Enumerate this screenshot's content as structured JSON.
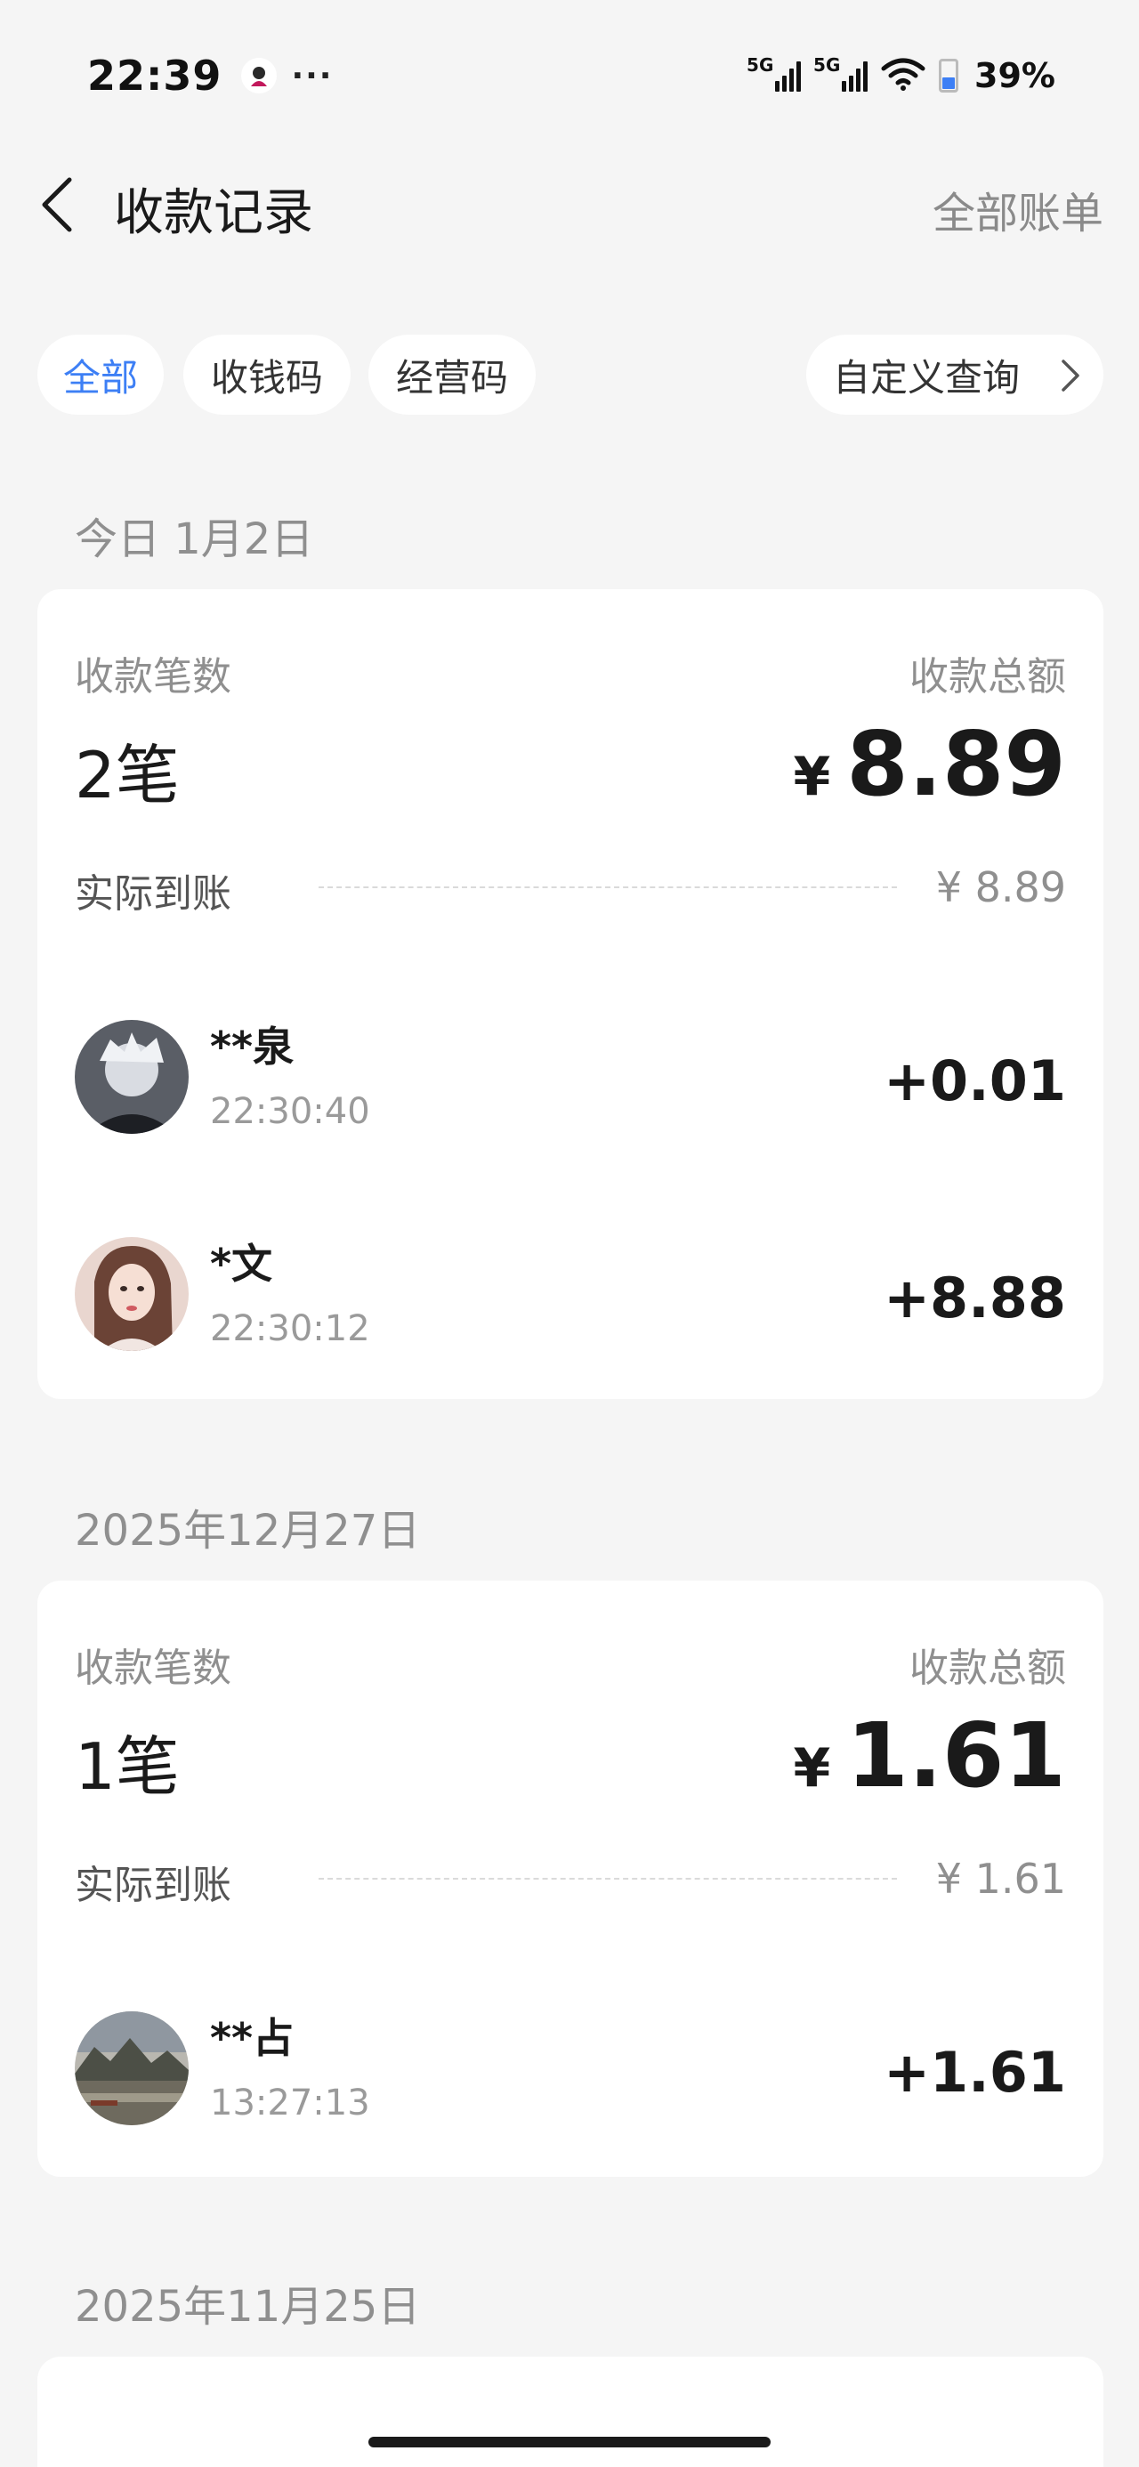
{
  "status_bar": {
    "time": "22:39",
    "dots": "···",
    "network_1": "5G",
    "network_2": "5G",
    "battery_percent": "39%",
    "battery_level": 0.39
  },
  "header": {
    "title": "收款记录",
    "right_link": "全部账单"
  },
  "filters": {
    "tabs": [
      {
        "label": "全部",
        "active": true
      },
      {
        "label": "收钱码",
        "active": false
      },
      {
        "label": "经营码",
        "active": false
      }
    ],
    "custom_query": "自定义查询"
  },
  "summary_labels": {
    "count": "收款笔数",
    "total": "收款总额",
    "received": "实际到账"
  },
  "sections": [
    {
      "date": "今日 1月2日",
      "count": "2笔",
      "currency": "¥",
      "total": "8.89",
      "received": "¥ 8.89",
      "transactions": [
        {
          "payer": "**泉",
          "time": "22:30:40",
          "amount": "+0.01"
        },
        {
          "payer": "*文",
          "time": "22:30:12",
          "amount": "+8.88"
        }
      ]
    },
    {
      "date": "2025年12月27日",
      "count": "1笔",
      "currency": "¥",
      "total": "1.61",
      "received": "¥ 1.61",
      "transactions": [
        {
          "payer": "**占",
          "time": "13:27:13",
          "amount": "+1.61"
        }
      ]
    },
    {
      "date": "2025年11月25日"
    }
  ],
  "colors": {
    "accent": "#3d7ff5",
    "background": "#f5f5f5",
    "card": "#ffffff"
  }
}
